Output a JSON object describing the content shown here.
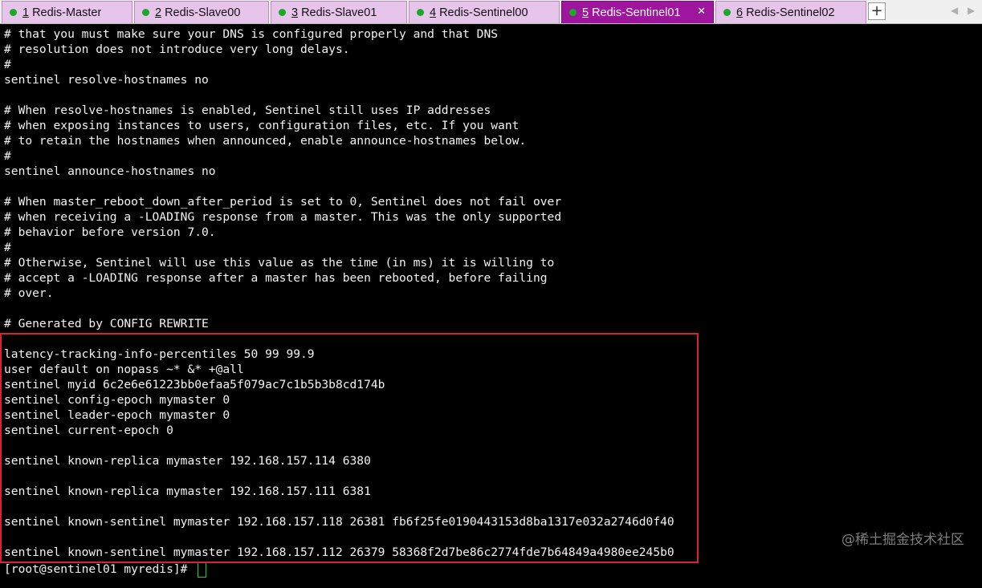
{
  "tabs": [
    {
      "number": "1",
      "title": "Redis-Master",
      "active": false
    },
    {
      "number": "2",
      "title": "Redis-Slave00",
      "active": false
    },
    {
      "number": "3",
      "title": "Redis-Slave01",
      "active": false
    },
    {
      "number": "4",
      "title": "Redis-Sentinel00",
      "active": false
    },
    {
      "number": "5",
      "title": "Redis-Sentinel01",
      "active": true
    },
    {
      "number": "6",
      "title": "Redis-Sentinel02",
      "active": false
    }
  ],
  "tabbar": {
    "close_glyph": "✕",
    "new_tab_glyph": "+",
    "prev_glyph": "◀",
    "next_glyph": "▶"
  },
  "terminal": {
    "lines": [
      "# that you must make sure your DNS is configured properly and that DNS",
      "# resolution does not introduce very long delays.",
      "#",
      "sentinel resolve-hostnames no",
      "",
      "# When resolve-hostnames is enabled, Sentinel still uses IP addresses",
      "# when exposing instances to users, configuration files, etc. If you want",
      "# to retain the hostnames when announced, enable announce-hostnames below.",
      "#",
      "sentinel announce-hostnames no",
      "",
      "# When master_reboot_down_after_period is set to 0, Sentinel does not fail over",
      "# when receiving a -LOADING response from a master. This was the only supported",
      "# behavior before version 7.0.",
      "#",
      "# Otherwise, Sentinel will use this value as the time (in ms) it is willing to",
      "# accept a -LOADING response after a master has been rebooted, before failing",
      "# over.",
      "",
      "# Generated by CONFIG REWRITE",
      "",
      "latency-tracking-info-percentiles 50 99 99.9",
      "user default on nopass ~* &* +@all",
      "sentinel myid 6c2e6e61223bb0efaa5f079ac7c1b5b3b8cd174b",
      "sentinel config-epoch mymaster 0",
      "sentinel leader-epoch mymaster 0",
      "sentinel current-epoch 0",
      "",
      "sentinel known-replica mymaster 192.168.157.114 6380",
      "",
      "sentinel known-replica mymaster 192.168.157.111 6381",
      "",
      "sentinel known-sentinel mymaster 192.168.157.118 26381 fb6f25fe0190443153d8ba1317e032a2746d0f40",
      "",
      "sentinel known-sentinel mymaster 192.168.157.112 26379 58368f2d7be86c2774fde7b64849a4980ee245b0",
      "[root@sentinel01 myredis]# "
    ]
  },
  "watermark": "@稀土掘金技术社区",
  "colors": {
    "tab_inactive": "#e7c4ea",
    "tab_active": "#a0159d",
    "status_dot": "#1aa82a",
    "highlight_border": "#d6232f",
    "cursor": "#1fd11f"
  }
}
